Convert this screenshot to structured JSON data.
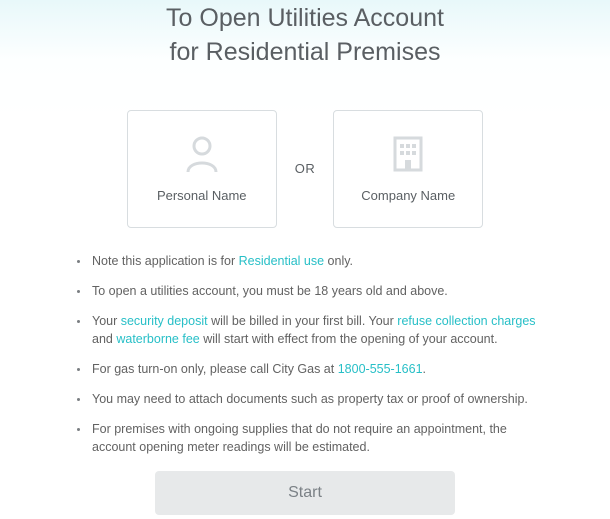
{
  "title_line1": "To Open Utilities Account",
  "title_line2": "for Residential Premises",
  "cards": {
    "personal": "Personal Name",
    "or": "OR",
    "company": "Company Name"
  },
  "notes": {
    "n1_a": "Note this application is for ",
    "n1_link": "Residential use",
    "n1_b": " only.",
    "n2": "To open a utilities account, you must be 18 years old and above.",
    "n3_a": "Your ",
    "n3_link1": "security deposit",
    "n3_b": " will be billed in your first bill. Your ",
    "n3_link2": "refuse collection charges",
    "n3_c": " and ",
    "n3_link3": "waterborne fee",
    "n3_d": " will start with effect from the opening of your account.",
    "n4_a": "For gas turn-on only, please call City Gas at ",
    "n4_link": "1800-555-1661",
    "n4_b": ".",
    "n5": "You may need to attach documents such as property tax or proof of ownership.",
    "n6": "For premises with ongoing supplies that do not require an appointment, the account opening meter readings will be estimated."
  },
  "start": "Start"
}
